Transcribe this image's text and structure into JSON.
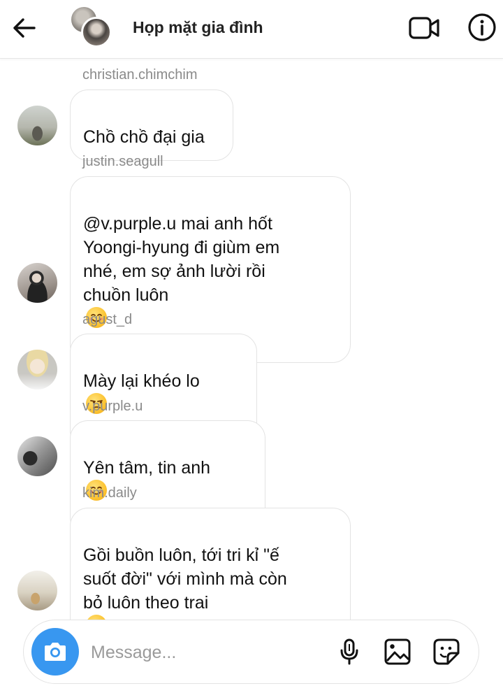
{
  "header": {
    "back_icon": "arrow-left-icon",
    "title": "Họp mặt gia đình",
    "video_icon": "video-camera-icon",
    "info_icon": "info-icon"
  },
  "messages": [
    {
      "sender": "christian.chimchim",
      "text": "Chồ chồ đại gia",
      "emoji": ""
    },
    {
      "sender": "justin.seagull",
      "text": "@v.purple.u mai anh hốt\nYoongi-hyung đi giùm em\nnhé, em sợ ảnh lười rồi\nchuồn luôn",
      "emoji": "smiling-face"
    },
    {
      "sender": "agust_d",
      "text": "Mày lại khéo lo",
      "emoji": "unamused-face"
    },
    {
      "sender": "v.purple.u",
      "text": "Yên tâm, tin anh",
      "emoji": "smiling-face"
    },
    {
      "sender": "kim.daily",
      "text": "Gồi buồn luôn, tới tri kỉ \"ế\nsuốt đời\" với mình mà còn\nbỏ luôn theo trai",
      "emoji": "smiling-face-with-tear"
    }
  ],
  "composer": {
    "camera_icon": "camera-icon",
    "placeholder": "Message...",
    "mic_icon": "microphone-icon",
    "gallery_icon": "image-icon",
    "sticker_icon": "sticker-icon"
  },
  "colors": {
    "accent": "#3897f0",
    "bubble_border": "#e3e3e3",
    "sender_name": "#8a8a8a"
  }
}
